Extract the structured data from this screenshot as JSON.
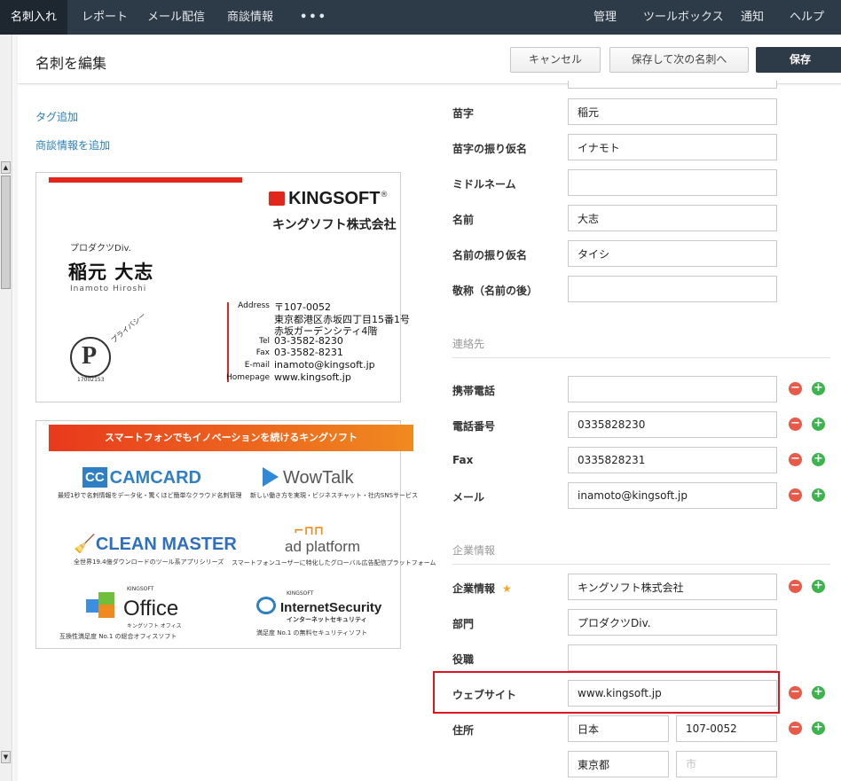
{
  "nav": {
    "items": [
      "名刺入れ",
      "レポート",
      "メール配信",
      "商談情報",
      "•••"
    ],
    "right": [
      "管理",
      "ツールボックス",
      "通知",
      "ヘルプ"
    ]
  },
  "header": {
    "title": "名刺を編集",
    "cancel": "キャンセル",
    "save_next": "保存して次の名刺へ",
    "save": "保存"
  },
  "links": {
    "add_tag": "タグ追加",
    "add_deal": "商談情報を追加"
  },
  "card_front": {
    "brand": "KINGSOFT",
    "registered": "®",
    "company": "キングソフト株式会社",
    "division": "プロダクツDiv.",
    "name": "稲元 大志",
    "roman": "Inamoto Hiroshi",
    "privacy_label": "プライバシー",
    "privacy_number": "17002153",
    "address_label": "Address",
    "address_lines": [
      "〒107-0052",
      "東京都港区赤坂四丁目15番1号",
      "赤坂ガーデンシティ4階"
    ],
    "tel_label": "Tel",
    "tel": "03-3582-8230",
    "fax_label": "Fax",
    "fax": "03-3582-8231",
    "email_label": "E-mail",
    "email": "inamoto@kingsoft.jp",
    "homepage_label": "Homepage",
    "homepage": "www.kingsoft.jp"
  },
  "card_back": {
    "banner": "スマートフォンでもイノベーションを続けるキングソフト",
    "products": [
      {
        "logo": "CAMCARD",
        "badge": "CC",
        "sub": "最短1秒で名刺情報をデータ化・驚くほど簡単なクラウド名刺管理"
      },
      {
        "logo": "WowTalk",
        "sub": "新しい働き方を実現・ビジネスチャット・社内SNSサービス"
      },
      {
        "logo": "CLEAN MASTER",
        "sub": "全世界19.4億ダウンロードのツール系アプリシリーズ"
      },
      {
        "logo": "ad platform",
        "sub": "スマートフォンユーザーに特化したグローバル広告配信プラットフォーム"
      },
      {
        "logo": "Office",
        "pre": "KINGSOFT",
        "kana": "キングソフト オフィス",
        "sub": "互換性満足度 No.1 の総合オフィスソフト"
      },
      {
        "logo": "InternetSecurity",
        "pre": "KINGSOFT",
        "kana": "インターネットセキュリティ",
        "sub": "満足度 No.1 の無料セキュリティソフト"
      }
    ]
  },
  "form": {
    "last_name_label": "苗字",
    "last_name": "稲元",
    "last_name_kana_label": "苗字の振り仮名",
    "last_name_kana": "イナモト",
    "middle_name_label": "ミドルネーム",
    "middle_name": "",
    "first_name_label": "名前",
    "first_name": "大志",
    "first_name_kana_label": "名前の振り仮名",
    "first_name_kana": "タイシ",
    "honorific_label": "敬称（名前の後）",
    "honorific": "",
    "contact_section": "連絡先",
    "mobile_label": "携帯電話",
    "mobile": "",
    "phone_label": "電話番号",
    "phone": "0335828230",
    "fax_label": "Fax",
    "fax": "0335828231",
    "mail_label": "メール",
    "mail": "inamoto@kingsoft.jp",
    "company_section": "企業情報",
    "company_label": "企業情報",
    "company_star": "★",
    "company": "キングソフト株式会社",
    "department_label": "部門",
    "department": "プロダクツDiv.",
    "position_label": "役職",
    "position": "",
    "website_label": "ウェブサイト",
    "website": "www.kingsoft.jp",
    "address_label": "住所",
    "country": "日本",
    "postal": "107-0052",
    "prefecture": "東京都",
    "city_placeholder": "市",
    "minus": "−",
    "plus": "+"
  },
  "colors": {
    "nav_bg": "#2d3a47",
    "save_bg": "#2d3a47",
    "link": "#2a7fb8",
    "minus": "#e8594a",
    "plus": "#3bb54a",
    "highlight": "#e0141f",
    "star": "#f5a623"
  }
}
